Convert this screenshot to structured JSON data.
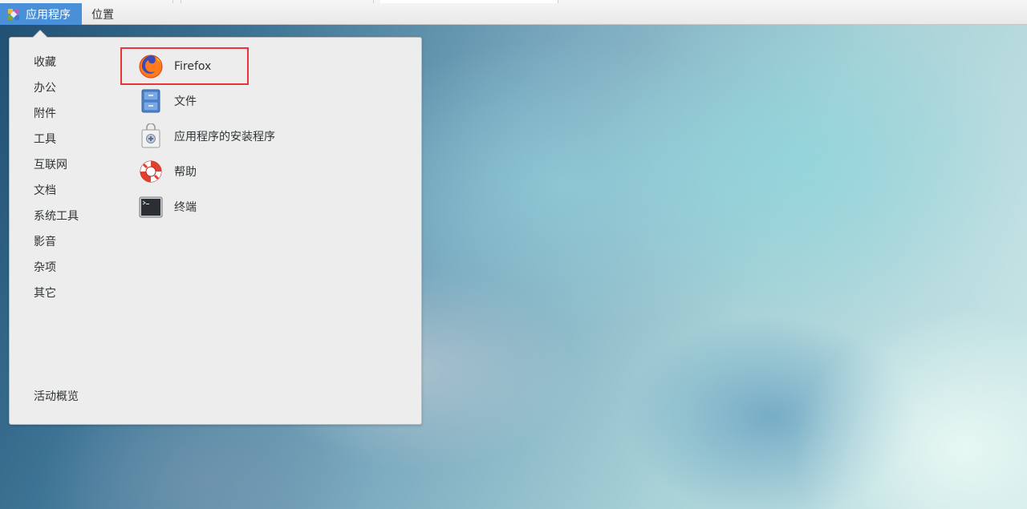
{
  "topbar": {
    "apps_label": "应用程序",
    "places_label": "位置"
  },
  "dropdown": {
    "categories": [
      "收藏",
      "办公",
      "附件",
      "工具",
      "互联网",
      "文档",
      "系统工具",
      "影音",
      "杂项",
      "其它"
    ],
    "overview_label": "活动概览",
    "apps": [
      {
        "label": "Firefox",
        "icon": "firefox-icon"
      },
      {
        "label": "文件",
        "icon": "file-cabinet-icon"
      },
      {
        "label": "应用程序的安装程序",
        "icon": "software-installer-icon"
      },
      {
        "label": "帮助",
        "icon": "help-lifebuoy-icon"
      },
      {
        "label": "终端",
        "icon": "terminal-icon"
      }
    ]
  },
  "colors": {
    "highlight": "#e8343a",
    "accent": "#4a90d9"
  }
}
